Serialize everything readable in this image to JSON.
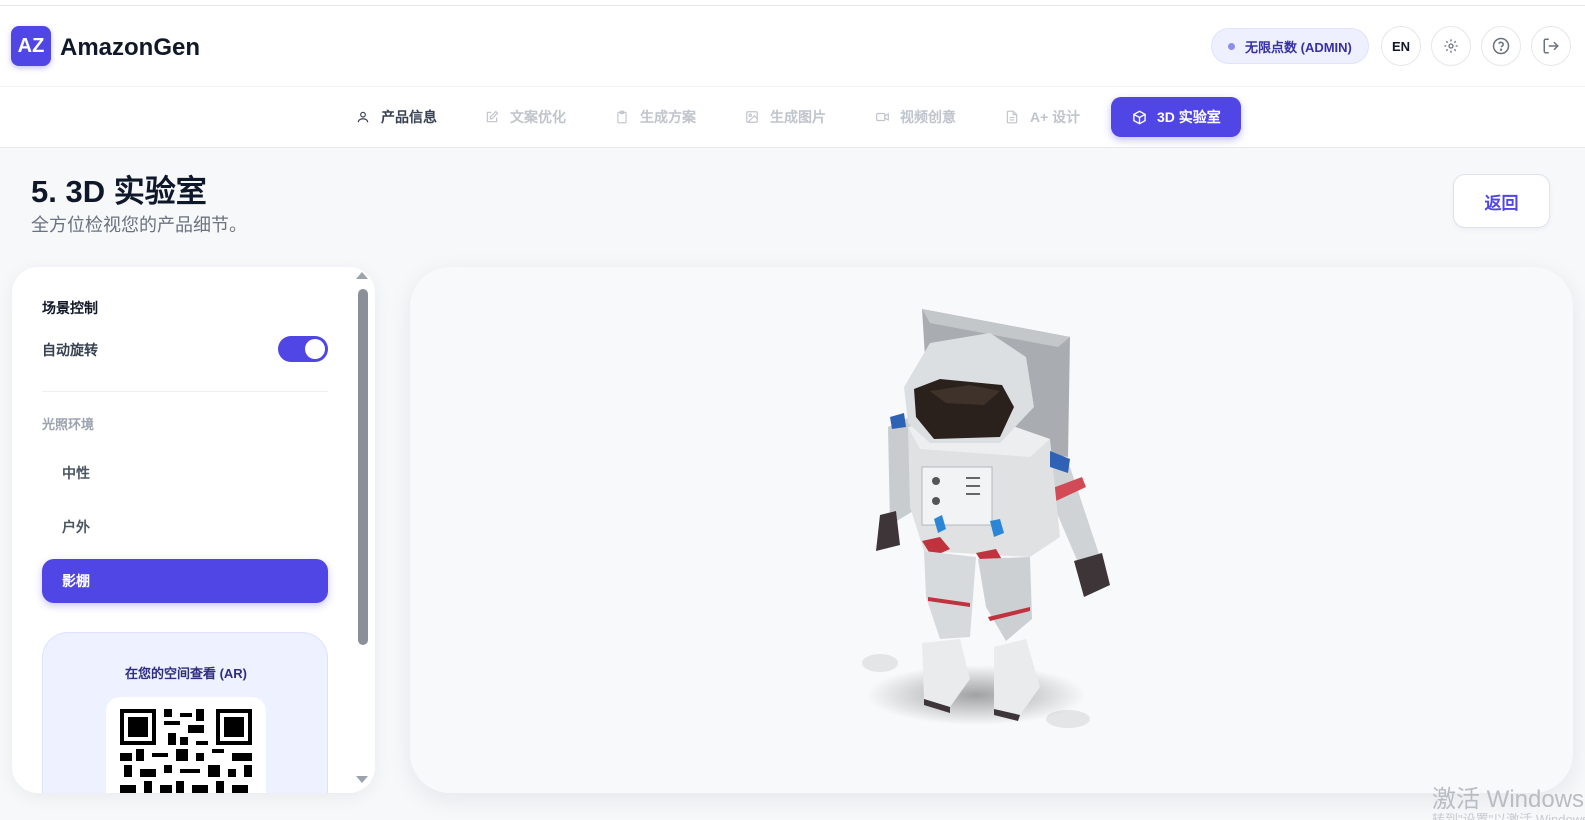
{
  "header": {
    "logo_text": "AZ",
    "brand": "AmazonGen",
    "credits": "无限点数 (ADMIN)",
    "lang": "EN"
  },
  "nav": {
    "tabs": [
      {
        "label": "产品信息",
        "icon": "user-icon",
        "state": "done"
      },
      {
        "label": "文案优化",
        "icon": "edit-icon",
        "state": "pending"
      },
      {
        "label": "生成方案",
        "icon": "clipboard-icon",
        "state": "pending"
      },
      {
        "label": "生成图片",
        "icon": "image-icon",
        "state": "pending"
      },
      {
        "label": "视频创意",
        "icon": "video-icon",
        "state": "pending"
      },
      {
        "label": "A+ 设计",
        "icon": "document-icon",
        "state": "pending"
      },
      {
        "label": "3D 实验室",
        "icon": "cube-icon",
        "state": "active"
      }
    ],
    "accent": "#4f46e5"
  },
  "page": {
    "title": "5. 3D 实验室",
    "subtitle": "全方位检视您的产品细节。",
    "back_label": "返回"
  },
  "scene": {
    "section_title": "场景控制",
    "auto_rotate_label": "自动旋转",
    "auto_rotate_on": true,
    "lighting_label": "光照环境",
    "lighting_options": [
      "中性",
      "户外",
      "影棚"
    ],
    "lighting_selected": "影棚"
  },
  "ar": {
    "title": "在您的空间查看 (AR)"
  },
  "watermark": {
    "line1": "激活 Windows",
    "line2": "转到\"设置\"以激活 Windows。"
  }
}
